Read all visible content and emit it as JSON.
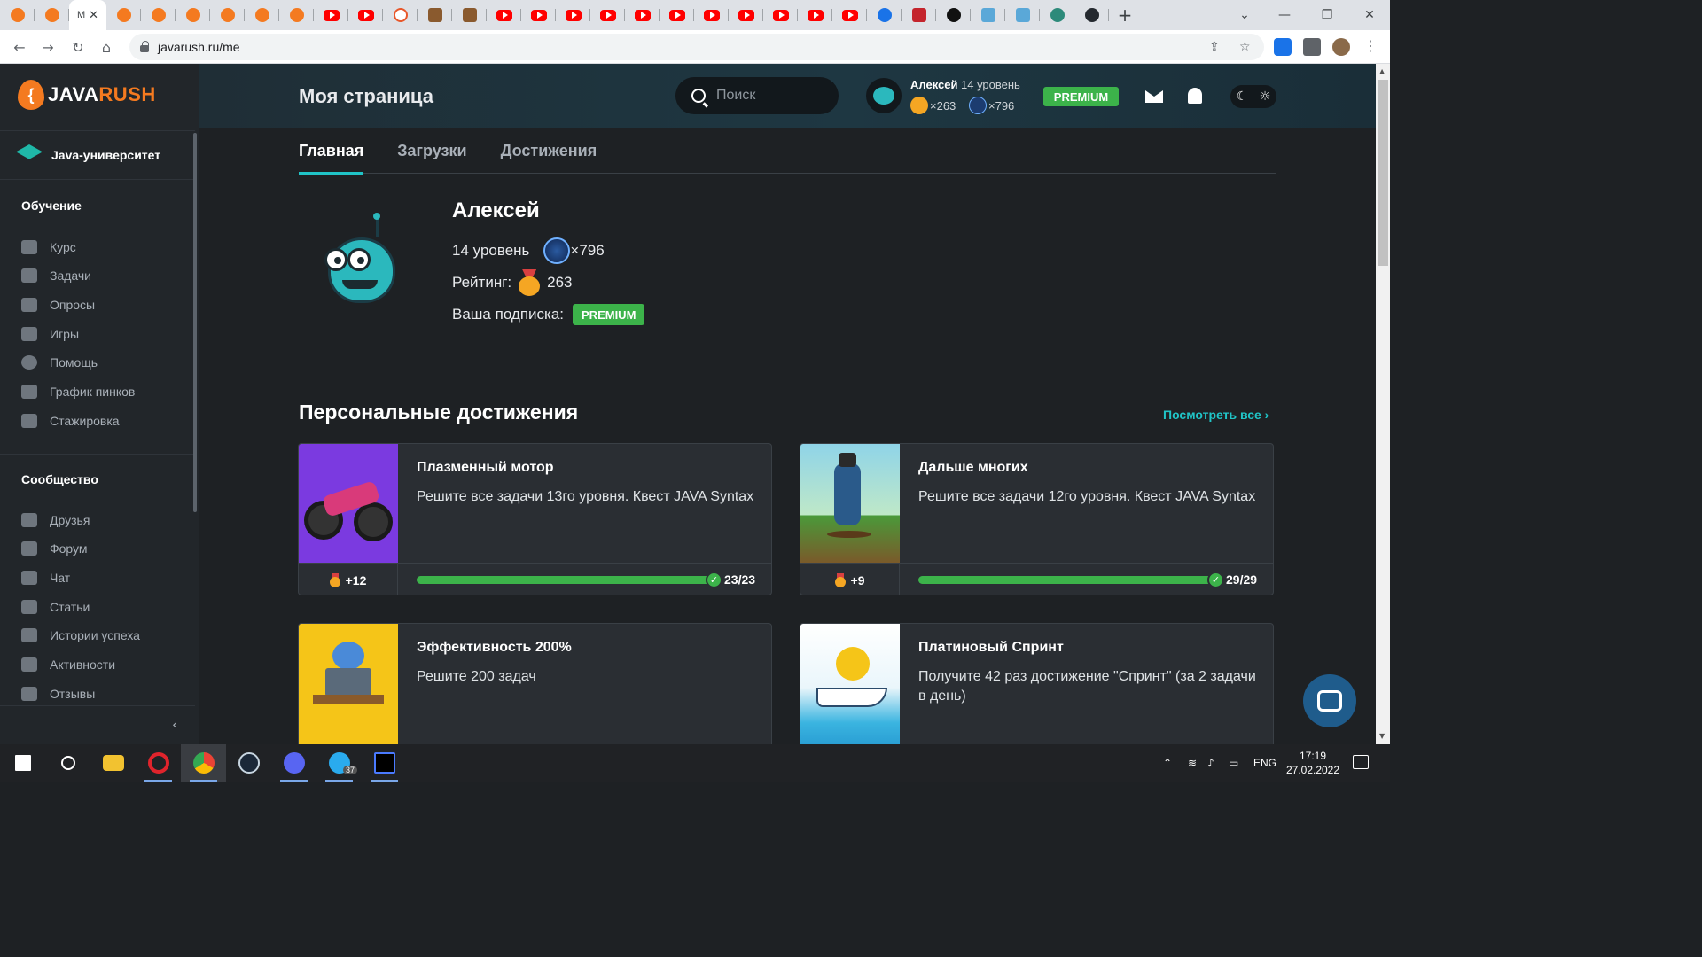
{
  "browser": {
    "tabs": [
      {
        "icon": "javarush-favicon"
      },
      {
        "icon": "javarush-favicon"
      },
      {
        "icon": "javarush-favicon",
        "active": true,
        "text": "М"
      },
      {
        "icon": "javarush-favicon"
      },
      {
        "icon": "javarush-favicon"
      },
      {
        "icon": "javarush-favicon"
      },
      {
        "icon": "javarush-favicon"
      },
      {
        "icon": "javarush-favicon"
      },
      {
        "icon": "javarush-favicon"
      },
      {
        "icon": "youtube-favicon"
      },
      {
        "icon": "youtube-favicon"
      },
      {
        "icon": "q-favicon"
      },
      {
        "icon": "s-favicon"
      },
      {
        "icon": "s-favicon"
      },
      {
        "icon": "youtube-favicon"
      },
      {
        "icon": "youtube-favicon"
      },
      {
        "icon": "youtube-favicon"
      },
      {
        "icon": "youtube-favicon"
      },
      {
        "icon": "youtube-favicon"
      },
      {
        "icon": "youtube-favicon"
      },
      {
        "icon": "youtube-favicon"
      },
      {
        "icon": "youtube-favicon"
      },
      {
        "icon": "youtube-favicon"
      },
      {
        "icon": "youtube-favicon"
      },
      {
        "icon": "youtube-favicon"
      },
      {
        "icon": "c-favicon"
      },
      {
        "icon": "ef-favicon"
      },
      {
        "icon": "squarespace-favicon"
      },
      {
        "icon": "blue-favicon"
      },
      {
        "icon": "blue-favicon"
      },
      {
        "icon": "teal-favicon"
      },
      {
        "icon": "github-favicon"
      }
    ],
    "url": "javarush.ru/me"
  },
  "sidebar": {
    "logo_java": "JAVA",
    "logo_rush": "RUSH",
    "university": "Java-университет",
    "learning_title": "Обучение",
    "learning_items": [
      "Курс",
      "Задачи",
      "Опросы",
      "Игры",
      "Помощь",
      "График пинков",
      "Стажировка"
    ],
    "community_title": "Сообщество",
    "community_items": [
      "Друзья",
      "Форум",
      "Чат",
      "Статьи",
      "Истории успеха",
      "Активности",
      "Отзывы"
    ]
  },
  "header": {
    "title": "Моя страница",
    "search_placeholder": "Поиск",
    "user_name": "Алексей",
    "user_level": "14 уровень",
    "rating": "×263",
    "mcoins": "×796",
    "premium": "PREMIUM"
  },
  "profile": {
    "tabs": [
      "Главная",
      "Загрузки",
      "Достижения"
    ],
    "name": "Алексей",
    "level": "14 уровень",
    "mcoins": "×796",
    "rating_label": "Рейтинг:",
    "rating": "263",
    "subscription_label": "Ваша подписка:",
    "subscription": "PREMIUM"
  },
  "achievements": {
    "title": "Персональные достижения",
    "see_all": "Посмотреть все ›",
    "cards": [
      {
        "title": "Плазменный мотор",
        "desc": "Решите все задачи 13го уровня. Квест JAVA Syntax",
        "reward": "+12",
        "progress": "23/23",
        "progress_fraction": 1.0
      },
      {
        "title": "Дальше многих",
        "desc": "Решите все задачи 12го уровня. Квест JAVA Syntax",
        "reward": "+9",
        "progress": "29/29",
        "progress_fraction": 1.0
      },
      {
        "title": "Эффективность 200%",
        "desc": "Решите 200 задач"
      },
      {
        "title": "Платиновый Спринт",
        "desc": "Получите 42 раз достижение \"Спринт\" (за 2 задачи в день)"
      }
    ]
  },
  "taskbar": {
    "language": "ENG",
    "time": "17:19",
    "date": "27.02.2022",
    "telegram_badge": "37"
  },
  "colors": {
    "accent": "#20c4c7",
    "premium": "#3cb34a",
    "brand": "#f47a20"
  }
}
